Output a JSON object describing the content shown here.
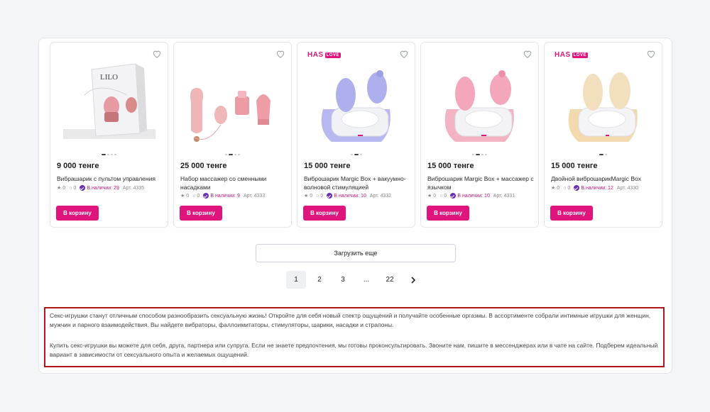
{
  "products": [
    {
      "price": "9 000 тенге",
      "name": "Вибрашарик с пультом управления",
      "rating": "0",
      "comments": "0",
      "stock": "В наличии: 29",
      "article": "Арт. 4335",
      "cart_label": "В корзину",
      "brand": "",
      "brand_tag": "",
      "image_icon": "lilo-box-icon"
    },
    {
      "price": "25 000 тенге",
      "name": "Набор массажер со сменными насадками",
      "rating": "0",
      "comments": "0",
      "stock": "В наличии: 9",
      "article": "Арт. 4333",
      "cart_label": "В корзину",
      "brand": "",
      "brand_tag": "",
      "image_icon": "massager-set-icon"
    },
    {
      "price": "15 000 тенге",
      "name": "Виброшарик Margic Box + вакуумно-волновой стимуляцией",
      "rating": "0",
      "comments": "0",
      "stock": "В наличии: 10",
      "article": "Арт. 4332",
      "cart_label": "В корзину",
      "brand": "HAS",
      "brand_tag": "LOVE",
      "image_icon": "magic-box-icon"
    },
    {
      "price": "15 000 тенге",
      "name": "Виброшарик Margic Box + массажер с язычком",
      "rating": "0",
      "comments": "0",
      "stock": "В наличии: 10",
      "article": "Арт. 4331",
      "cart_label": "В корзину",
      "brand": "",
      "brand_tag": "",
      "image_icon": "magic-box-icon"
    },
    {
      "price": "15 000 тенге",
      "name": "Двойной виброшарикMargic Box",
      "rating": "0",
      "comments": "0",
      "stock": "В наличии: 12",
      "article": "Арт. 4330",
      "cart_label": "В корзину",
      "brand": "HAS",
      "brand_tag": "LOVE",
      "image_icon": "magic-box-icon"
    }
  ],
  "load_more_label": "Загрузить еще",
  "pagination": {
    "pages": [
      "1",
      "2",
      "3",
      "...",
      "22"
    ],
    "current": "1",
    "next_icon": "chevron-right-icon"
  },
  "seo_text": [
    "Секс-игрушки станут отличным способом разнообразить сексуальную жизнь! Откройте для себя новый спектр ощущений и получайте особенные оргазмы. В ассортименте собрали интимные игрушки для женщин, мужчин и парного взаимодействия. Вы найдете вибраторы, фаллоимитаторы, стимуляторы, шарики, насадки и страпоны.",
    "Купить секс-игрушки вы можете для себя, друга, партнера или супруга. Если не знаете предпочтения, мы готовы проконсультировать. Звоните нам, пишите в мессенджерах или в чате на сайте. Подберем идеальный вариант в зависимости от сексуального опыта и желаемых ощущений."
  ],
  "colors": {
    "accent": "#e0147d",
    "stock_check": "#6a2fb6",
    "highlight_border": "#b5141e"
  }
}
